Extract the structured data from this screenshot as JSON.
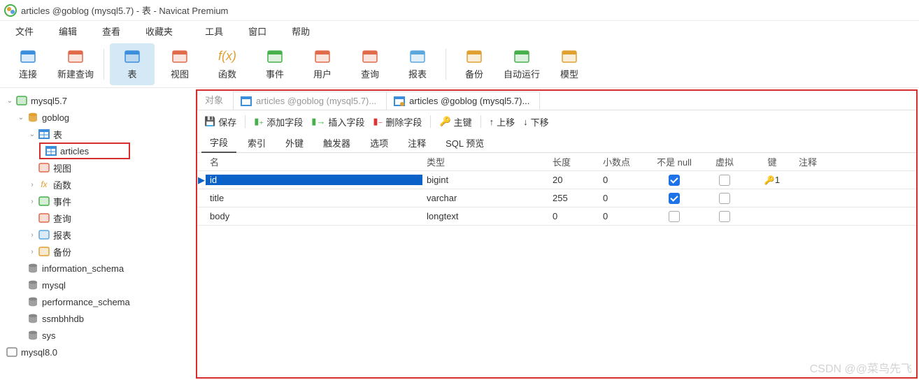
{
  "window": {
    "title": "articles @goblog (mysql5.7) - 表 - Navicat Premium"
  },
  "menu": {
    "items": [
      "文件",
      "编辑",
      "查看",
      "收藏夹",
      "工具",
      "窗口",
      "帮助"
    ]
  },
  "toolbar": {
    "items": [
      {
        "label": "连接",
        "icon": "connect-icon",
        "accent": "#3b8edb"
      },
      {
        "label": "新建查询",
        "icon": "new-query-icon",
        "accent": "#e06a4a"
      },
      {
        "label": "表",
        "icon": "table-icon",
        "accent": "#3b8edb",
        "active": true
      },
      {
        "label": "视图",
        "icon": "view-icon",
        "accent": "#e06a4a"
      },
      {
        "label": "函数",
        "icon": "function-icon",
        "accent": "#e0a030",
        "glyph": "f(x)"
      },
      {
        "label": "事件",
        "icon": "event-icon",
        "accent": "#47b04b"
      },
      {
        "label": "用户",
        "icon": "user-icon",
        "accent": "#e06a4a"
      },
      {
        "label": "查询",
        "icon": "query-icon",
        "accent": "#e06a4a"
      },
      {
        "label": "报表",
        "icon": "report-icon",
        "accent": "#5aa6dd"
      },
      {
        "label": "备份",
        "icon": "backup-icon",
        "accent": "#e0a030"
      },
      {
        "label": "自动运行",
        "icon": "autorun-icon",
        "accent": "#47b04b"
      },
      {
        "label": "模型",
        "icon": "model-icon",
        "accent": "#e0a030"
      }
    ]
  },
  "tree": {
    "conn": "mysql5.7",
    "db": "goblog",
    "tables_label": "表",
    "table_items": [
      "articles"
    ],
    "db_children": [
      {
        "label": "视图",
        "icon": "view-icon",
        "color": "#e06a4a"
      },
      {
        "label": "函数",
        "icon": "function-icon",
        "color": "#e0a030",
        "glyph": "fx",
        "arrow": true
      },
      {
        "label": "事件",
        "icon": "event-icon",
        "color": "#47b04b",
        "arrow": true
      },
      {
        "label": "查询",
        "icon": "query-icon",
        "color": "#e06a4a"
      },
      {
        "label": "报表",
        "icon": "report-icon",
        "color": "#5aa6dd",
        "arrow": true
      },
      {
        "label": "备份",
        "icon": "backup-icon",
        "color": "#e0a030",
        "arrow": true
      }
    ],
    "other_dbs": [
      "information_schema",
      "mysql",
      "performance_schema",
      "ssmbhhdb",
      "sys"
    ],
    "other_conn": "mysql8.0"
  },
  "content": {
    "tabs": [
      {
        "label": "对象",
        "kind": "plain"
      },
      {
        "label": "articles @goblog (mysql5.7)...",
        "kind": "table"
      },
      {
        "label": "articles @goblog (mysql5.7)...",
        "kind": "design",
        "active": true
      }
    ],
    "actions": {
      "save": "保存",
      "add": "添加字段",
      "insert": "插入字段",
      "delete": "删除字段",
      "pk": "主键",
      "up": "上移",
      "down": "下移"
    },
    "subtabs": [
      "字段",
      "索引",
      "外键",
      "触发器",
      "选项",
      "注释",
      "SQL 预览"
    ],
    "grid": {
      "headers": {
        "name": "名",
        "type": "类型",
        "len": "长度",
        "dec": "小数点",
        "null": "不是 null",
        "virt": "虚拟",
        "key": "键",
        "comm": "注释"
      },
      "rows": [
        {
          "name": "id",
          "type": "bigint",
          "len": "20",
          "dec": "0",
          "notnull": true,
          "virt": false,
          "key": "1",
          "sel": true
        },
        {
          "name": "title",
          "type": "varchar",
          "len": "255",
          "dec": "0",
          "notnull": true,
          "virt": false,
          "key": ""
        },
        {
          "name": "body",
          "type": "longtext",
          "len": "0",
          "dec": "0",
          "notnull": false,
          "virt": false,
          "key": ""
        }
      ]
    }
  },
  "watermark": "CSDN @@菜鸟先飞"
}
